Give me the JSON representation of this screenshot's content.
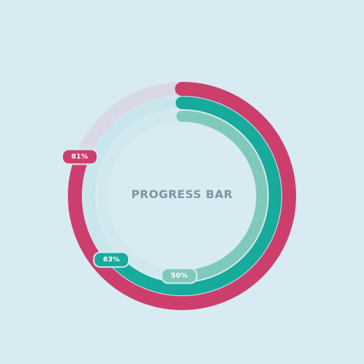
{
  "title": "PROGRESS BAR",
  "colors": {
    "background": "#d8ebf3",
    "title": "#7e959e"
  },
  "rings": [
    {
      "name": "outer",
      "percent": 81,
      "label": "81%",
      "color": "#cc3f6d",
      "track_color": "#d9d9e6"
    },
    {
      "name": "middle",
      "percent": 63,
      "label": "63%",
      "color": "#17ab9b",
      "track_color": "#c9e6ec"
    },
    {
      "name": "inner",
      "percent": 50,
      "label": "50%",
      "color": "#80cabb",
      "track_color": "#d2e8ef"
    }
  ]
}
